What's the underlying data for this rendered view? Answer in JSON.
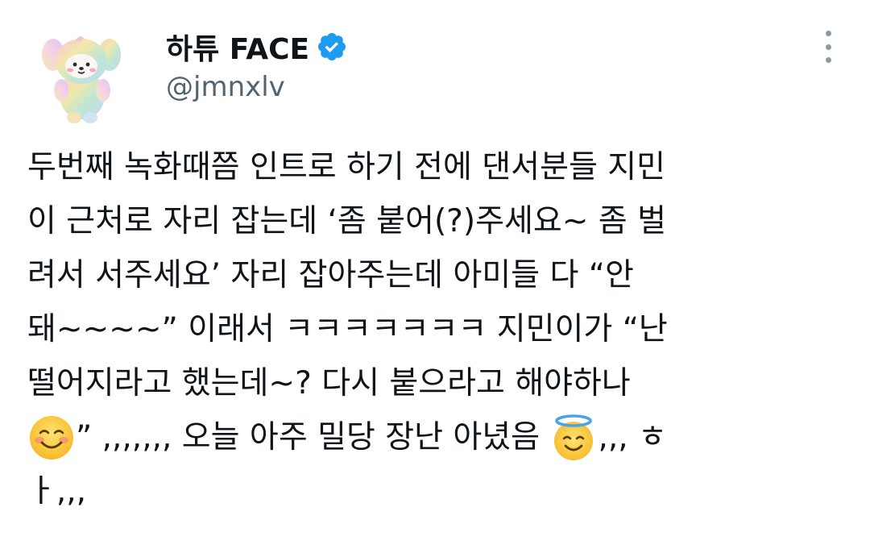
{
  "author": {
    "display_name": "하튜 FACE",
    "handle": "@jmnxlv",
    "verified": true,
    "avatar_icon": "plush-puppy-avatar-icon",
    "accent_color": "#1d9bf0"
  },
  "menu": {
    "icon": "more-vertical-icon"
  },
  "tweet": {
    "lines": [
      "두번째 녹화때쯤 인트로 하기 전에 댄서분들 지민",
      "이 근처로 자리 잡는데 ‘좀 붙어(?)주세요~ 좀 벌",
      "려서 서주세요’ 자리 잡아주는데 아미들 다 “안",
      "돼~~~~” 이래서 ㅋㅋㅋㅋㅋㅋㅋ 지민이가 “난",
      "떨어지라고 했는데~? 다시 붙으라고 해야하나"
    ],
    "line6_after_emoji": "” ,,,,,,, 오늘 아주 밀당 장난 아녔음 ",
    "line6_tail": ",,, ㅎ",
    "line7": "ㅏ,,,",
    "emojis": [
      "smiling-face-icon",
      "smiling-face-with-halo-icon"
    ]
  }
}
